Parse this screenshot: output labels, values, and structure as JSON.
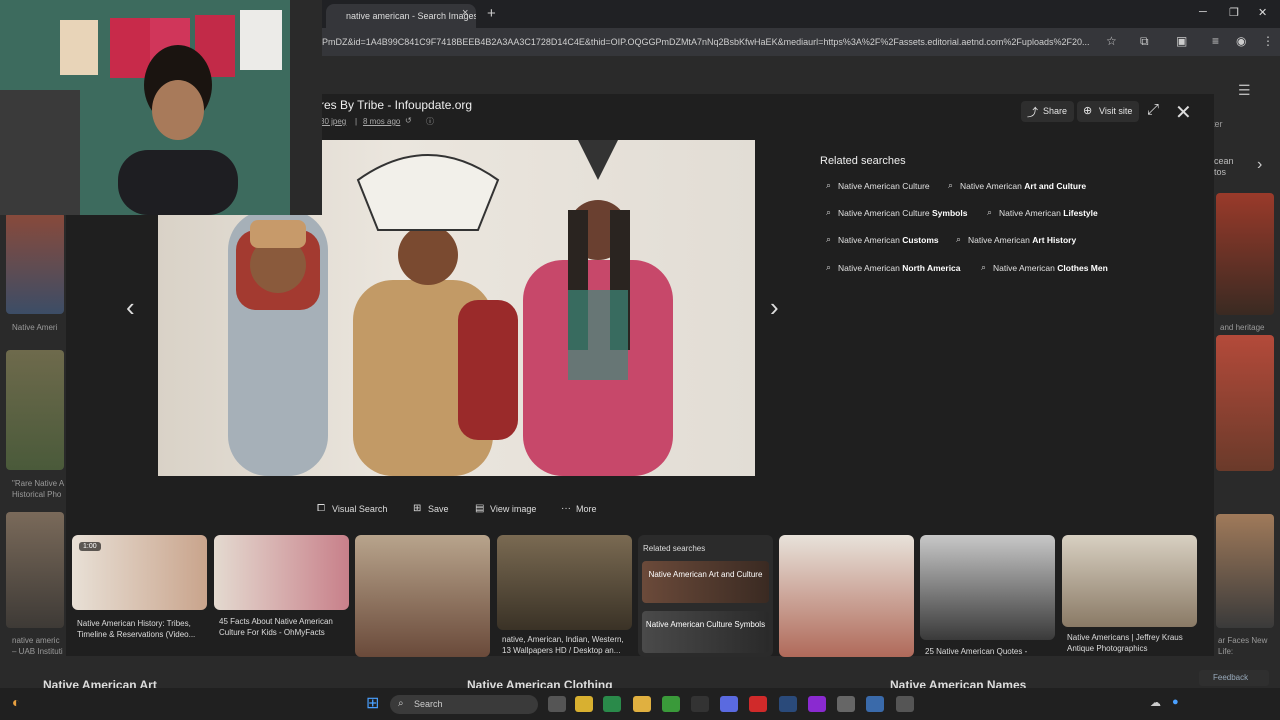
{
  "browser": {
    "tab_title": "native american - Search Images",
    "tab_close": "×",
    "new_tab": "+",
    "url": "PmDZ&id=1A4B99C841C9F7418BEEB4B2A3AA3C1728D14C4E&thid=OIP.OQGGPmDZMtA7nNq2BsbKfwHaEK&mediaurl=https%3A%2F%2Fassets.editorial.aetnd.com%2Fuploads%2F20..."
  },
  "modal": {
    "title": "res By Tribe - Infoupdate.org",
    "meta_size": "80 jpeg",
    "meta_sep": "|",
    "meta_time": "8 mos ago",
    "share_label": "Share",
    "visit_label": "Visit site",
    "related_title": "Related searches",
    "related": [
      {
        "plain": "Native American Culture",
        "bold": ""
      },
      {
        "plain": "Native American ",
        "bold": "Art and Culture"
      },
      {
        "plain": "Native American Culture ",
        "bold": "Symbols"
      },
      {
        "plain": "Native American ",
        "bold": "Lifestyle"
      },
      {
        "plain": "Native American ",
        "bold": "Customs"
      },
      {
        "plain": "Native American ",
        "bold": "Art History"
      },
      {
        "plain": "Native American ",
        "bold": "North America"
      },
      {
        "plain": "Native American ",
        "bold": "Clothes Men"
      }
    ],
    "actions": {
      "visual_search": "Visual Search",
      "save": "Save",
      "view_image": "View image",
      "more": "More"
    },
    "strip": {
      "badge": "1:00",
      "cap1": "Native American History: Tribes, Timeline & Reservations (Video...",
      "cap2": "45 Facts About Native American Culture For Kids - OhMyFacts",
      "cap4": "native, American, Indian, Western, 13 Wallpapers HD / Desktop an...",
      "related_title": "Related searches",
      "related_item1": "Native American Art and Culture",
      "related_item2": "Native American Culture Symbols",
      "cap7": "25 Native American Quotes -",
      "cap8": "Native Americans | Jeffrey Kraus Antique Photographics"
    }
  },
  "background": {
    "cap_left1": "Native Ameri",
    "cap_left2": "\"Rare Native A Historical Pho",
    "cap_left3": "native americ – UAB Instituti",
    "cap_right1": "and heritage",
    "cap_right2": "ar Faces New Life:",
    "partial_top": "cean tos",
    "filter": "ter"
  },
  "bottom": {
    "cat1": "Native American Art",
    "cat2": "Native American Clothing",
    "cat3": "Native American Names",
    "feedback": "Feedback"
  },
  "taskbar": {
    "search_placeholder": "Search"
  }
}
